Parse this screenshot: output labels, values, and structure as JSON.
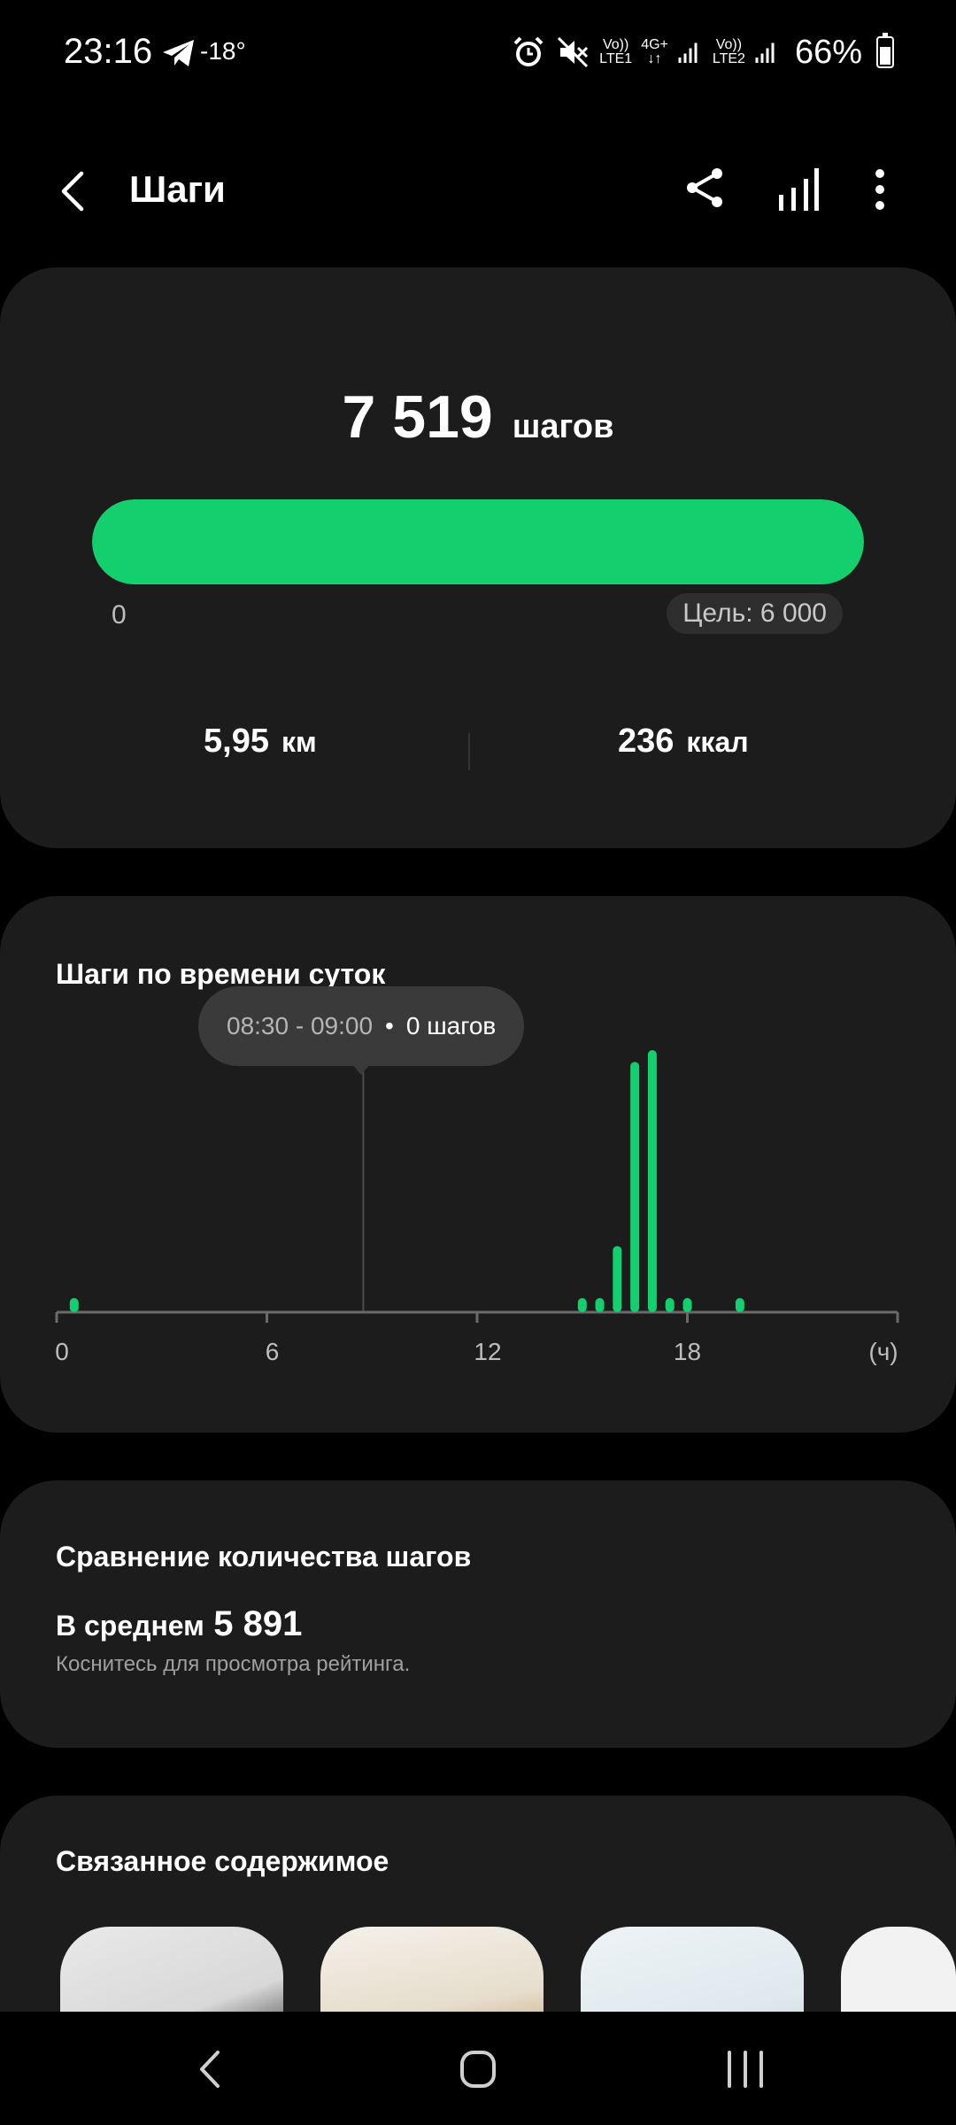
{
  "status_bar": {
    "time": "23:16",
    "temperature": "-18°",
    "battery": "66%",
    "sim1_top": "Vo))",
    "sim1_bottom": "LTE1",
    "network_type": "4G+",
    "sim2_top": "Vo))",
    "sim2_bottom": "LTE2",
    "icons": [
      "telegram-icon",
      "alarm-icon",
      "mute-icon",
      "signal-icon",
      "battery-icon"
    ]
  },
  "app_bar": {
    "title": "Шаги"
  },
  "summary": {
    "steps_value": "7 519",
    "steps_unit": "шагов",
    "progress_fraction": 1.0,
    "progress_start": "0",
    "goal": "Цель: 6 000",
    "distance_value": "5,95",
    "distance_unit": "км",
    "calories_value": "236",
    "calories_unit": "ккал"
  },
  "chart": {
    "title": "Шаги по времени суток",
    "tooltip_time": "08:30 - 09:00",
    "tooltip_value": "0 шагов",
    "tick_labels": [
      "0",
      "6",
      "12",
      "18",
      "(ч)"
    ],
    "accent": "#13cf6e"
  },
  "chart_data": {
    "type": "bar",
    "title": "Шаги по времени суток",
    "xlabel": "(ч)",
    "xlim": [
      0,
      24
    ],
    "x_ticks": [
      0,
      6,
      12,
      18
    ],
    "x": [
      0.5,
      15.0,
      15.5,
      16.0,
      16.5,
      17.0,
      17.5,
      18.0,
      19.5
    ],
    "values": [
      60,
      60,
      60,
      280,
      1060,
      1110,
      60,
      60,
      60
    ],
    "selected_interval": "08:30 - 09:00",
    "selected_value": 0
  },
  "compare": {
    "title": "Сравнение количества шагов",
    "avg_label": "В среднем",
    "avg_value": "5 891",
    "hint": "Коснитесь для просмотра рейтинга."
  },
  "related": {
    "title": "Связанное содержимое"
  }
}
